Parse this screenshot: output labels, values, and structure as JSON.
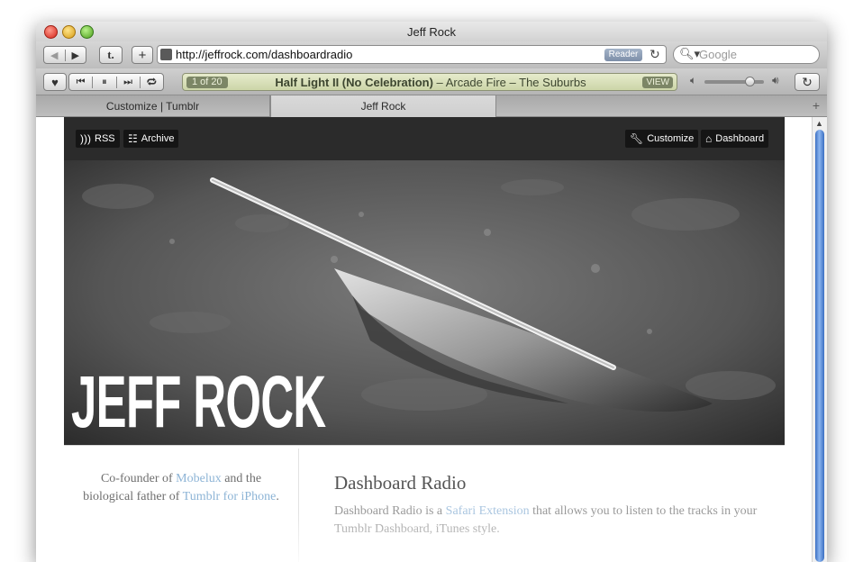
{
  "window": {
    "title": "Jeff Rock"
  },
  "toolbar": {
    "back_icon": "back-arrow-icon",
    "forward_icon": "forward-arrow-icon",
    "tumblr_label": "t.",
    "add_label": "+",
    "url": "http://jeffrock.com/dashboardradio",
    "reader_label": "Reader",
    "search_placeholder": "Google"
  },
  "media": {
    "count_label": "1 of 20",
    "track_title": "Half Light II (No Celebration)",
    "artist": "Arcade Fire",
    "album": "The Suburbs",
    "separator": "–",
    "view_label": "VIEW"
  },
  "tabs": [
    {
      "label": "Customize | Tumblr"
    },
    {
      "label": "Jeff Rock"
    }
  ],
  "page": {
    "nav": {
      "rss_label": "RSS",
      "archive_label": "Archive",
      "customize_label": "Customize",
      "dashboard_label": "Dashboard"
    },
    "hero_title": "JEFF ROCK",
    "bio": {
      "prefix": "Co-founder of ",
      "link1": "Mobelux",
      "middle": " and the biological father of ",
      "link2": "Tumblr for iPhone",
      "suffix": "."
    },
    "post": {
      "title": "Dashboard Radio",
      "body_prefix": "Dashboard Radio is a ",
      "body_link": "Safari Extension",
      "body_suffix": " that allows you to listen to the tracks in your Tumblr Dashboard, iTunes style."
    }
  },
  "colors": {
    "accent_link": "#8db4d6",
    "lcd_bg": "#d8dfbb",
    "nav_bg": "#2b2b2b"
  }
}
